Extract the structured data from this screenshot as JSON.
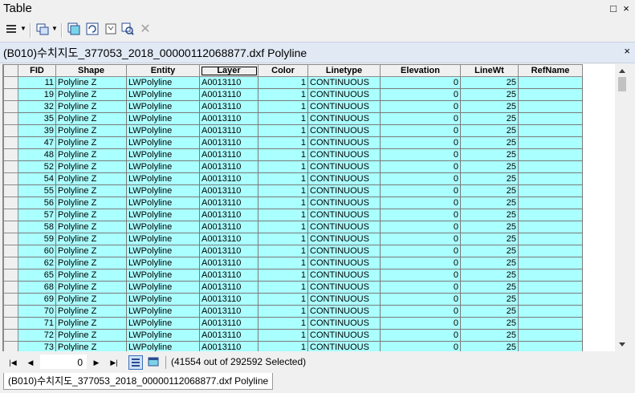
{
  "window": {
    "title": "Table",
    "pin_glyph": "□",
    "close_glyph": "×"
  },
  "toolbar": {
    "tools": [
      "table-options-icon",
      "related-tables-icon",
      "select-by-attributes-icon",
      "switch-selection-icon",
      "clear-selection-icon",
      "zoom-to-selected-icon",
      "delete-selected-icon"
    ]
  },
  "tab": {
    "title": "(B010)수치지도_377053_2018_00000112068877.dxf Polyline",
    "close_glyph": "×"
  },
  "table": {
    "columns": [
      "FID",
      "Shape",
      "Entity",
      "Layer",
      "Color",
      "Linetype",
      "Elevation",
      "LineWt",
      "RefName"
    ],
    "active_column": "Layer",
    "rows": [
      [
        "11",
        "Polyline Z",
        "LWPolyline",
        "A0013110",
        "1",
        "CONTINUOUS",
        "0",
        "25",
        ""
      ],
      [
        "19",
        "Polyline Z",
        "LWPolyline",
        "A0013110",
        "1",
        "CONTINUOUS",
        "0",
        "25",
        ""
      ],
      [
        "32",
        "Polyline Z",
        "LWPolyline",
        "A0013110",
        "1",
        "CONTINUOUS",
        "0",
        "25",
        ""
      ],
      [
        "35",
        "Polyline Z",
        "LWPolyline",
        "A0013110",
        "1",
        "CONTINUOUS",
        "0",
        "25",
        ""
      ],
      [
        "39",
        "Polyline Z",
        "LWPolyline",
        "A0013110",
        "1",
        "CONTINUOUS",
        "0",
        "25",
        ""
      ],
      [
        "47",
        "Polyline Z",
        "LWPolyline",
        "A0013110",
        "1",
        "CONTINUOUS",
        "0",
        "25",
        ""
      ],
      [
        "48",
        "Polyline Z",
        "LWPolyline",
        "A0013110",
        "1",
        "CONTINUOUS",
        "0",
        "25",
        ""
      ],
      [
        "52",
        "Polyline Z",
        "LWPolyline",
        "A0013110",
        "1",
        "CONTINUOUS",
        "0",
        "25",
        ""
      ],
      [
        "54",
        "Polyline Z",
        "LWPolyline",
        "A0013110",
        "1",
        "CONTINUOUS",
        "0",
        "25",
        ""
      ],
      [
        "55",
        "Polyline Z",
        "LWPolyline",
        "A0013110",
        "1",
        "CONTINUOUS",
        "0",
        "25",
        ""
      ],
      [
        "56",
        "Polyline Z",
        "LWPolyline",
        "A0013110",
        "1",
        "CONTINUOUS",
        "0",
        "25",
        ""
      ],
      [
        "57",
        "Polyline Z",
        "LWPolyline",
        "A0013110",
        "1",
        "CONTINUOUS",
        "0",
        "25",
        ""
      ],
      [
        "58",
        "Polyline Z",
        "LWPolyline",
        "A0013110",
        "1",
        "CONTINUOUS",
        "0",
        "25",
        ""
      ],
      [
        "59",
        "Polyline Z",
        "LWPolyline",
        "A0013110",
        "1",
        "CONTINUOUS",
        "0",
        "25",
        ""
      ],
      [
        "60",
        "Polyline Z",
        "LWPolyline",
        "A0013110",
        "1",
        "CONTINUOUS",
        "0",
        "25",
        ""
      ],
      [
        "62",
        "Polyline Z",
        "LWPolyline",
        "A0013110",
        "1",
        "CONTINUOUS",
        "0",
        "25",
        ""
      ],
      [
        "65",
        "Polyline Z",
        "LWPolyline",
        "A0013110",
        "1",
        "CONTINUOUS",
        "0",
        "25",
        ""
      ],
      [
        "68",
        "Polyline Z",
        "LWPolyline",
        "A0013110",
        "1",
        "CONTINUOUS",
        "0",
        "25",
        ""
      ],
      [
        "69",
        "Polyline Z",
        "LWPolyline",
        "A0013110",
        "1",
        "CONTINUOUS",
        "0",
        "25",
        ""
      ],
      [
        "70",
        "Polyline Z",
        "LWPolyline",
        "A0013110",
        "1",
        "CONTINUOUS",
        "0",
        "25",
        ""
      ],
      [
        "71",
        "Polyline Z",
        "LWPolyline",
        "A0013110",
        "1",
        "CONTINUOUS",
        "0",
        "25",
        ""
      ],
      [
        "72",
        "Polyline Z",
        "LWPolyline",
        "A0013110",
        "1",
        "CONTINUOUS",
        "0",
        "25",
        ""
      ],
      [
        "73",
        "Polyline Z",
        "LWPolyline",
        "A0013110",
        "1",
        "CONTINUOUS",
        "0",
        "25",
        ""
      ]
    ]
  },
  "statusbar": {
    "record_value": "0",
    "status_text": "(41554 out of 292592 Selected)"
  },
  "bottom_tab": {
    "label": "(B010)수치지도_377053_2018_00000112068877.dxf Polyline"
  },
  "colors": {
    "selected_row": "#aaffff",
    "header": "#f0f0f0",
    "tab_header": "#e1e9f5"
  }
}
